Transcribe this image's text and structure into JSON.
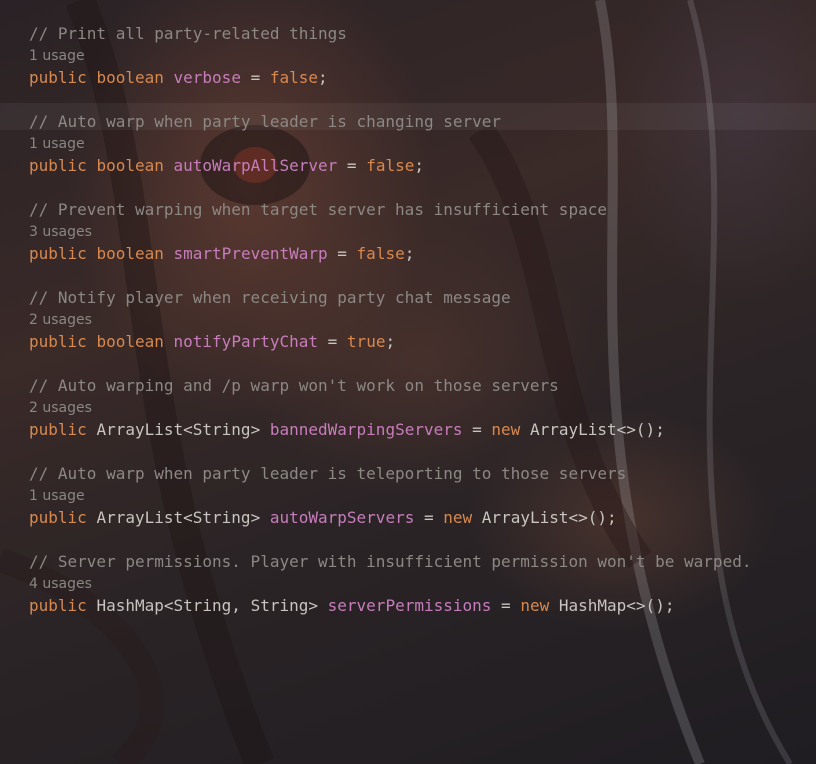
{
  "fields": [
    {
      "comment": "// Print all party-related things",
      "usage": "1 usage",
      "modifier": "public",
      "type": "boolean",
      "type_is_keyword": true,
      "name": "verbose",
      "value": "false"
    },
    {
      "comment": "// Auto warp when party leader is changing server",
      "usage": "1 usage",
      "modifier": "public",
      "type": "boolean",
      "type_is_keyword": true,
      "name": "autoWarpAllServer",
      "value": "false"
    },
    {
      "comment": "// Prevent warping when target server has insufficient space",
      "usage": "3 usages",
      "modifier": "public",
      "type": "boolean",
      "type_is_keyword": true,
      "name": "smartPreventWarp",
      "value": "false"
    },
    {
      "comment": "// Notify player when receiving party chat message",
      "usage": "2 usages",
      "modifier": "public",
      "type": "boolean",
      "type_is_keyword": true,
      "name": "notifyPartyChat",
      "value": "true"
    },
    {
      "comment": "// Auto warping and /p warp won't work on those servers",
      "usage": "2 usages",
      "modifier": "public",
      "type": "ArrayList<String>",
      "type_is_keyword": false,
      "name": "bannedWarpingServers",
      "new_keyword": "new",
      "value": "ArrayList<>()"
    },
    {
      "comment": "// Auto warp when party leader is teleporting to those servers",
      "usage": "1 usage",
      "modifier": "public",
      "type": "ArrayList<String>",
      "type_is_keyword": false,
      "name": "autoWarpServers",
      "new_keyword": "new",
      "value": "ArrayList<>()"
    },
    {
      "comment": "// Server permissions. Player with insufficient permission won't be warped.",
      "usage": "4 usages",
      "modifier": "public",
      "type": "HashMap<String, String>",
      "type_is_keyword": false,
      "name": "serverPermissions",
      "new_keyword": "new",
      "value": "HashMap<>()"
    }
  ],
  "colors": {
    "keyword": "#d8894f",
    "field": "#c77dbb",
    "comment": "#8c8884",
    "text": "#c8c4bf",
    "usage": "#8a8682"
  }
}
